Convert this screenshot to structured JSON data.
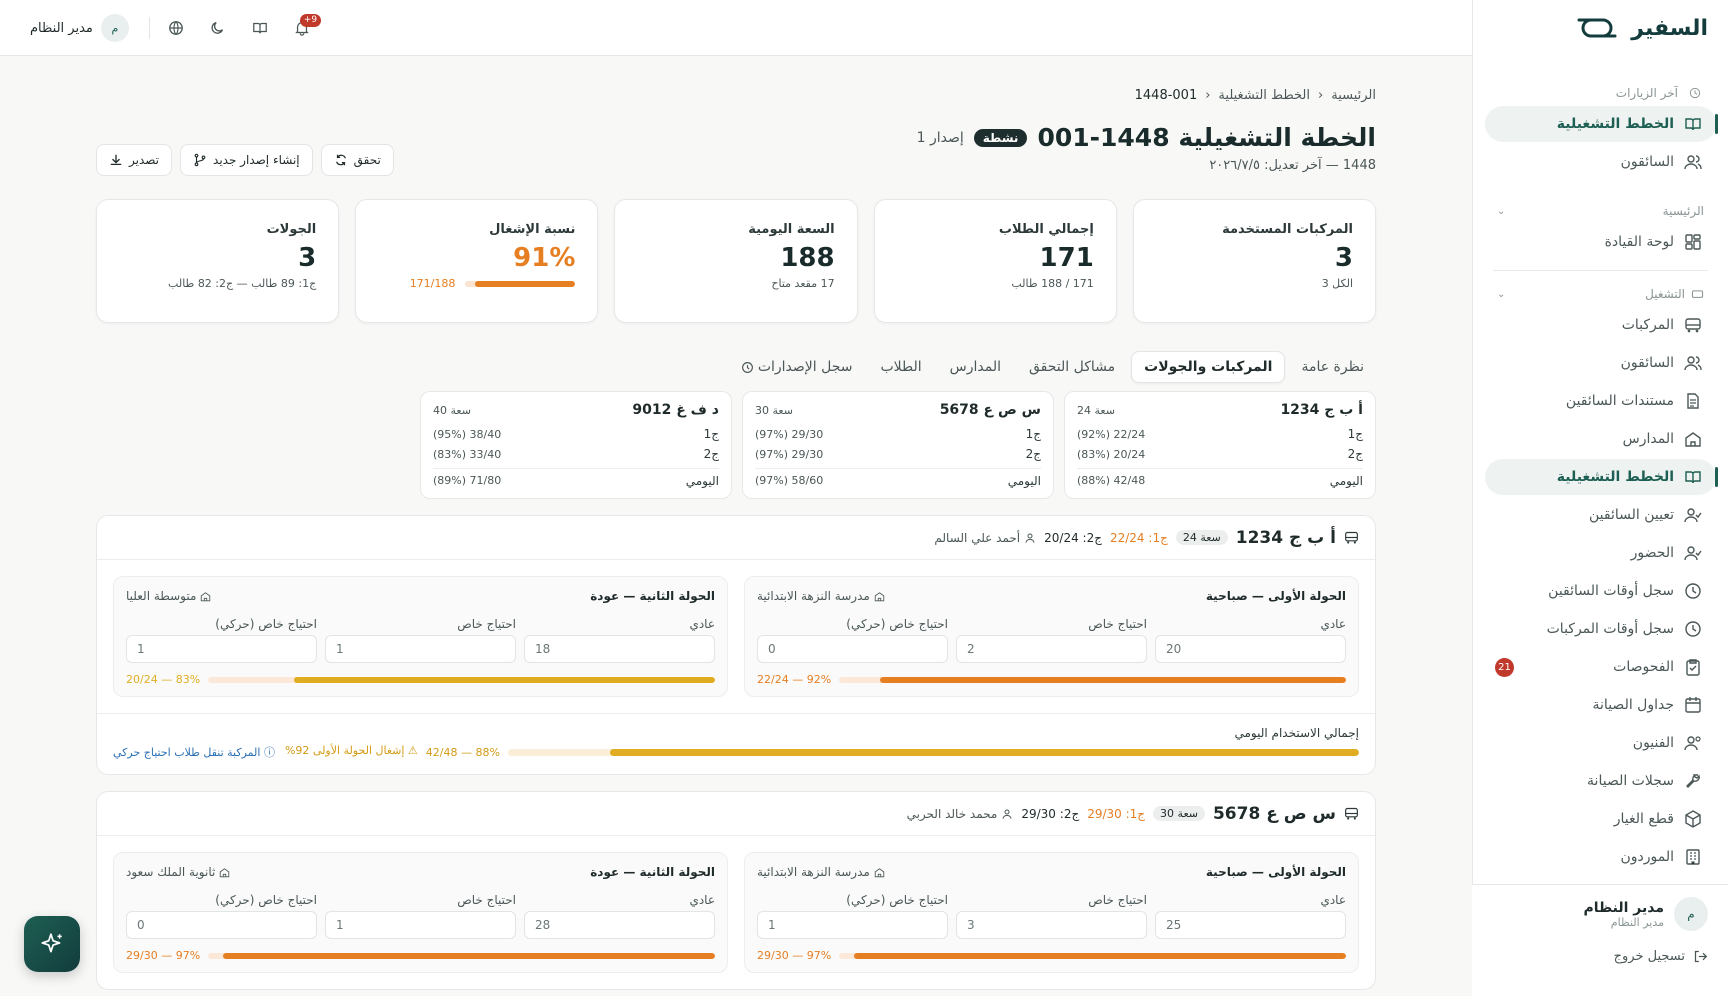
{
  "brand": {
    "name": "السفير"
  },
  "sidebar": {
    "recent_label": "آخر الزيارات",
    "recent_items": [
      {
        "label": "الخطط التشغيلية",
        "icon": "book-open-icon",
        "active": true
      },
      {
        "label": "السائقون",
        "icon": "users-icon"
      }
    ],
    "home_group": "الرئيسية",
    "home_items": [
      {
        "label": "لوحة القيادة",
        "icon": "dashboard-icon"
      }
    ],
    "ops_group": "التشغيل",
    "ops_items": [
      {
        "label": "المركبات",
        "icon": "bus-icon"
      },
      {
        "label": "السائقون",
        "icon": "users-icon"
      },
      {
        "label": "مستندات السائقين",
        "icon": "document-icon"
      },
      {
        "label": "المدارس",
        "icon": "school-icon"
      },
      {
        "label": "الخطط التشغيلية",
        "icon": "book-open-icon",
        "active": true
      },
      {
        "label": "تعيين السائقين",
        "icon": "user-check-icon"
      },
      {
        "label": "الحضور",
        "icon": "user-check-icon"
      },
      {
        "label": "سجل أوقات السائقين",
        "icon": "clock-icon"
      },
      {
        "label": "سجل أوقات المركبات",
        "icon": "clock-icon"
      },
      {
        "label": "الفحوصات",
        "icon": "clipboard-icon",
        "badge": "21"
      },
      {
        "label": "جداول الصيانة",
        "icon": "calendar-icon"
      },
      {
        "label": "الفنيون",
        "icon": "user-gear-icon"
      },
      {
        "label": "سجلات الصيانة",
        "icon": "wrench-icon"
      },
      {
        "label": "قطع الغيار",
        "icon": "package-icon"
      },
      {
        "label": "الموردون",
        "icon": "building-icon"
      }
    ],
    "user": {
      "initial": "م",
      "name": "مدير النظام",
      "role": "مدير النظام"
    },
    "logout": "تسجيل خروج"
  },
  "topbar": {
    "user_name": "مدير النظام",
    "user_initial": "م",
    "notif_badge": "+9"
  },
  "breadcrumb": {
    "home": "الرئيسية",
    "section": "الخطط التشغيلية",
    "current": "1448-001"
  },
  "header": {
    "title": "الخطة التشغيلية 1448-001",
    "status": "نشطة",
    "version": "إصدار 1",
    "subtitle": "1448 — آخر تعديل: ٢٠٢٦/٧/٥"
  },
  "actions": {
    "verify": "تحقق",
    "new_version": "إنشاء إصدار جديد",
    "export": "تصدير"
  },
  "stats": [
    {
      "label": "المركبات المستخدمة",
      "value": "3",
      "sub": "الكل 3"
    },
    {
      "label": "إجمالي الطلاب",
      "value": "171",
      "sub": "171 / 188 طالب"
    },
    {
      "label": "السعة اليومية",
      "value": "188",
      "sub": "17 مقعد متاح"
    },
    {
      "label": "نسبة الإشغال",
      "value": "91%",
      "bar_label": "171/188",
      "fill": 0.91
    },
    {
      "label": "الجولات",
      "value": "3",
      "sub": "ج1: 89 طالب — ج2: 82 طالب"
    }
  ],
  "tabs": [
    "نظرة عامة",
    "المركبات والجولات",
    "مشاكل التحقق",
    "المدارس",
    "الطلاب",
    "سجل الإصدارات"
  ],
  "vehicle_cards": [
    {
      "plate": "أ ب ج 1234",
      "capacity": "سعة 24",
      "t1_label": "ج1",
      "t1": "22/24 (92%)",
      "t2_label": "ج2",
      "t2": "20/24 (83%)",
      "daily_label": "اليومي",
      "daily": "42/48 (88%)"
    },
    {
      "plate": "س ص ع 5678",
      "capacity": "سعة 30",
      "t1_label": "ج1",
      "t1": "29/30 (97%)",
      "t2_label": "ج2",
      "t2": "29/30 (97%)",
      "daily_label": "اليومي",
      "daily": "58/60 (97%)"
    },
    {
      "plate": "د ف غ 9012",
      "capacity": "سعة 40",
      "t1_label": "ج1",
      "t1": "38/40 (95%)",
      "t2_label": "ج2",
      "t2": "33/40 (83%)",
      "daily_label": "اليومي",
      "daily": "71/80 (89%)"
    }
  ],
  "sections": [
    {
      "plate": "أ ب ج 1234",
      "capacity": "سعة 24",
      "t1": "ج1: 22/24",
      "t2": "ج2: 20/24",
      "driver": "أحمد علي السالم",
      "trips": [
        {
          "title": "الحولة الأولى — صباحية",
          "school": "مدرسة النزهة الابتدائية",
          "f1_label": "عادي",
          "f1": "20",
          "f2_label": "احتياج خاص",
          "f2": "2",
          "f3_label": "احتياج خاص (حركي)",
          "f3": "0",
          "bar_label": "92% — 22/24",
          "fill": 0.92,
          "color": "#e67e22"
        },
        {
          "title": "الحولة الثانية — عودة",
          "school": "متوسطة العليا",
          "f1_label": "عادي",
          "f1": "18",
          "f2_label": "احتياج خاص",
          "f2": "1",
          "f3_label": "احتياج خاص (حركي)",
          "f3": "1",
          "bar_label": "83% — 20/24",
          "fill": 0.83,
          "color": "#e0ad22"
        }
      ],
      "daily_title": "إجمالي الاستخدام اليومي",
      "daily_label": "88% — 42/48",
      "daily_fill": 0.88,
      "note_warn": "إشغال الحولة الأولى 92%",
      "note_info": "المركبة تنقل طلاب احتياج حركي"
    },
    {
      "plate": "س ص ع 5678",
      "capacity": "سعة 30",
      "t1": "ج1: 29/30",
      "t2": "ج2: 29/30",
      "driver": "محمد خالد الحربي",
      "trips": [
        {
          "title": "الحولة الأولى — صباحية",
          "school": "مدرسة النزهة الابتدائية",
          "f1_label": "عادي",
          "f1": "25",
          "f2_label": "احتياج خاص",
          "f2": "3",
          "f3_label": "احتياج خاص (حركي)",
          "f3": "1",
          "bar_label": "97% — 29/30",
          "fill": 0.97,
          "color": "#e67e22"
        },
        {
          "title": "الحولة الثانية — عودة",
          "school": "ثانوية الملك سعود",
          "f1_label": "عادي",
          "f1": "28",
          "f2_label": "احتياج خاص",
          "f2": "1",
          "f3_label": "احتياج خاص (حركي)",
          "f3": "0",
          "bar_label": "97% — 29/30",
          "fill": 0.97,
          "color": "#e67e22"
        }
      ]
    }
  ]
}
